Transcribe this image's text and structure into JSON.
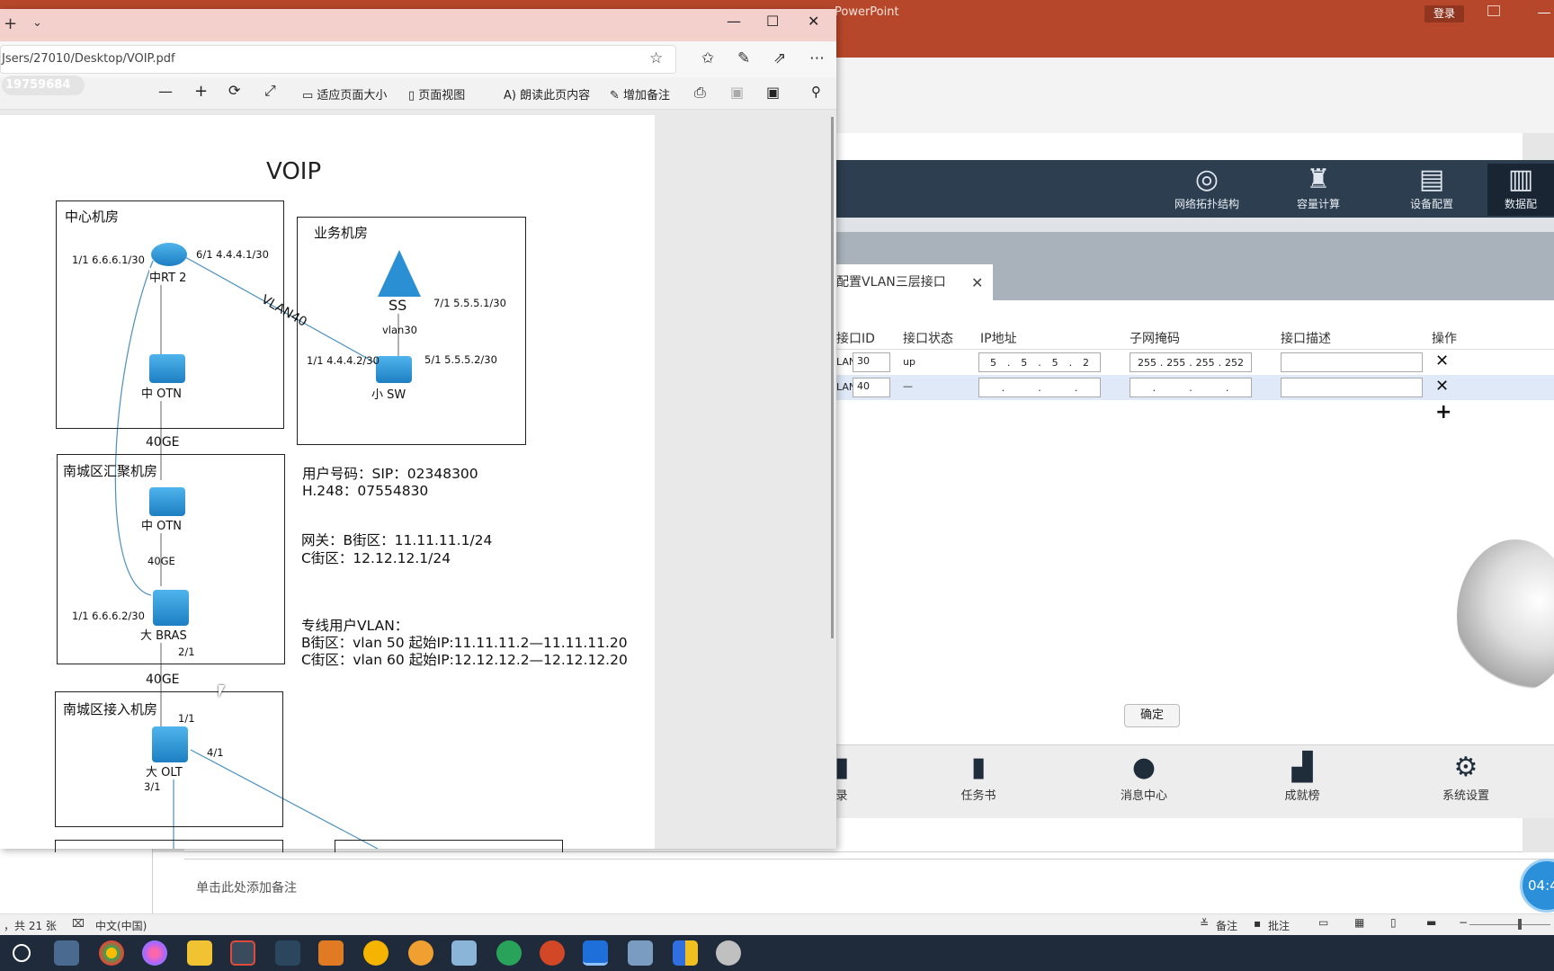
{
  "ppt": {
    "title_fragment": "PowerPoint",
    "login": "登录",
    "notes_placeholder": "单击此处添加备注",
    "status_slides": "，共 21 张",
    "status_lang": "中文(中国)",
    "status_notes": "备注",
    "status_comments": "批注"
  },
  "edge": {
    "address": "Jsers/27010/Desktop/VOIP.pdf",
    "page_number": "19759684",
    "toolbar": {
      "fit_page": "适应页面大小",
      "page_view": "页面视图",
      "read_aloud": "朗读此页内容",
      "add_notes": "增加备注"
    }
  },
  "diagram": {
    "title": "VOIP",
    "room_center": "中心机房",
    "room_service": "业务机房",
    "room_south_agg": "南城区汇聚机房",
    "room_south_access": "南城区接入机房",
    "rt2": "中RT 2",
    "rt2_p1": "1/1  6.6.6.1/30",
    "rt2_p6": "6/1  4.4.4.1/30",
    "vlan40": "VLAN40",
    "ss": "SS",
    "ss_port": "7/1  5.5.5.1/30",
    "vlan30": "vlan30",
    "sw": "小 SW",
    "sw_p1": "1/1  4.4.4.2/30",
    "sw_p5": "5/1  5.5.5.2/30",
    "otn1": "中 OTN",
    "otn2": "中 OTN",
    "link_40ge_1": "40GE",
    "link_40ge_2": "40GE",
    "link_40ge_3": "40GE",
    "bras": "大 BRAS",
    "bras_p1": "1/1  6.6.6.2/30",
    "bras_p2": "2/1",
    "olt": "大 OLT",
    "olt_p1": "1/1",
    "olt_p4": "4/1",
    "olt_p3": "3/1",
    "note_user_1": "用户号码：SIP：02348300",
    "note_user_2": "H.248：07554830",
    "note_gw_1": "网关：B街区：11.11.11.1/24",
    "note_gw_2": "C街区：12.12.12.1/24",
    "note_vlan_1": "专线用户VLAN：",
    "note_vlan_2": "B街区：vlan 50 起始IP:11.11.11.2—11.11.11.20",
    "note_vlan_3": "C街区：vlan 60 起始IP:12.12.12.2—12.12.12.20"
  },
  "app": {
    "nav": [
      {
        "label": "网络拓扑结构",
        "icon": "globe-icon"
      },
      {
        "label": "容量计算",
        "icon": "tower-icon"
      },
      {
        "label": "设备配置",
        "icon": "server-icon"
      },
      {
        "label": "数据配",
        "icon": "document-icon"
      }
    ],
    "tab_label": "配置VLAN三层接口",
    "headers": {
      "id": "接口ID",
      "status": "接口状态",
      "ip": "IP地址",
      "mask": "子网掩码",
      "desc": "接口描述",
      "op": "操作"
    },
    "rows": [
      {
        "prefix": "LAN",
        "id": "30",
        "status": "up",
        "ip": [
          "5",
          "5",
          "5",
          "2"
        ],
        "mask": [
          "255",
          "255",
          "255",
          "252"
        ],
        "desc": ""
      },
      {
        "prefix": "LAN",
        "id": "40",
        "status": "—",
        "ip": [
          "",
          "",
          "",
          ""
        ],
        "mask": [
          "",
          "",
          "",
          ""
        ],
        "desc": ""
      }
    ],
    "confirm": "确定",
    "bottom_nav": [
      "录",
      "任务书",
      "消息中心",
      "成就榜",
      "系统设置"
    ],
    "timer": "04:4"
  }
}
